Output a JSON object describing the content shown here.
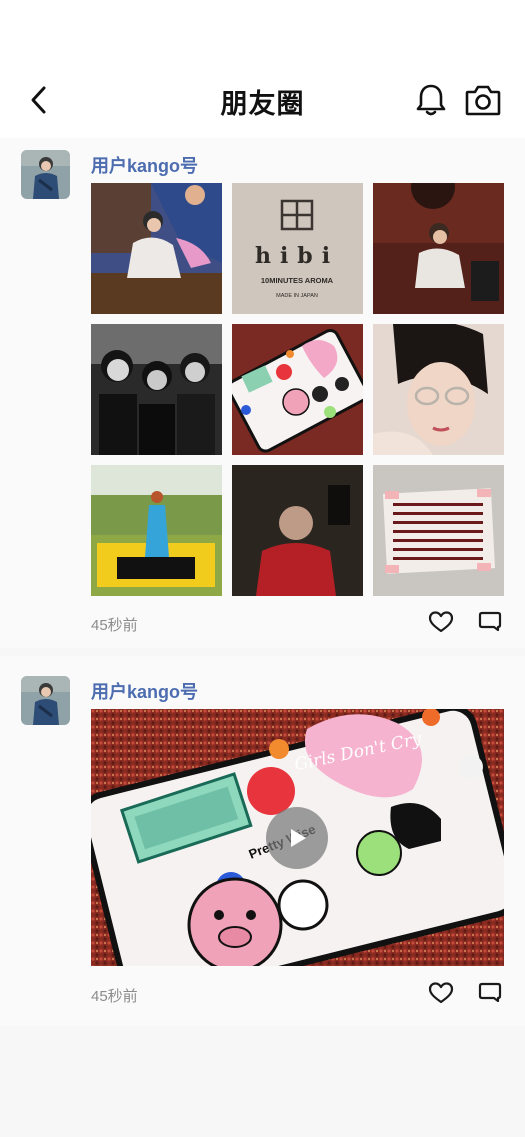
{
  "header": {
    "title": "朋友圈",
    "back_icon": "chevron-left-icon",
    "bell_icon": "bell-icon",
    "camera_icon": "camera-icon"
  },
  "colors": {
    "username": "#4d6db0",
    "time": "#8c8c8c",
    "background": "#f7f7f8"
  },
  "posts": [
    {
      "username": "用户kango号",
      "time": "45秒前",
      "media_type": "image-grid",
      "image_count": 9,
      "grid_text": {
        "brand": "hibi",
        "brand_sub": "10MINUTES AROMA",
        "brand_origin": "MADE IN JAPAN"
      }
    },
    {
      "username": "用户kango号",
      "time": "45秒前",
      "media_type": "video",
      "video_text": {
        "sticker_title": "Girls Don't Cry",
        "sticker_pig": "Pretty Wise"
      }
    }
  ]
}
